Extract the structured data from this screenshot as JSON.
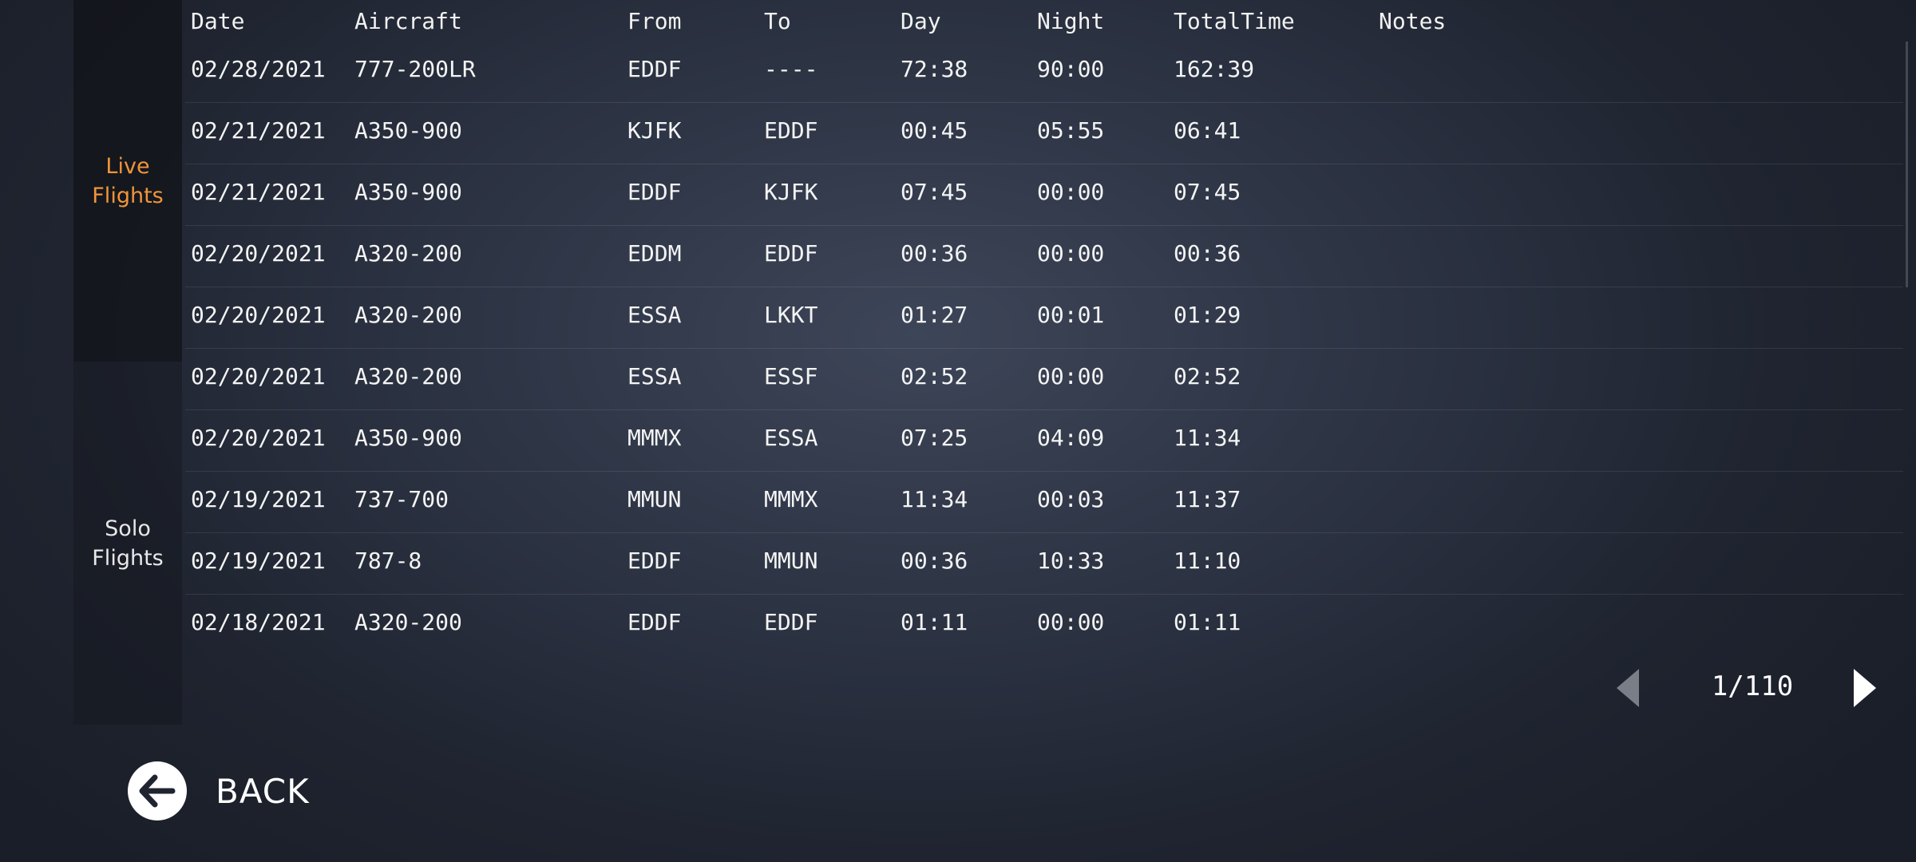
{
  "sidebar": {
    "tabs": [
      {
        "label_line1": "Live",
        "label_line2": "Flights",
        "active": true
      },
      {
        "label_line1": "Solo",
        "label_line2": "Flights",
        "active": false
      }
    ]
  },
  "table": {
    "headers": {
      "date": "Date",
      "aircraft": "Aircraft",
      "from": "From",
      "to": "To",
      "day": "Day",
      "night": "Night",
      "total": "TotalTime",
      "notes": "Notes"
    },
    "rows": [
      {
        "date": "02/28/2021",
        "aircraft": "777-200LR",
        "from": "EDDF",
        "to": "----",
        "day": "72:38",
        "night": "90:00",
        "total": "162:39",
        "notes": ""
      },
      {
        "date": "02/21/2021",
        "aircraft": "A350-900",
        "from": "KJFK",
        "to": "EDDF",
        "day": "00:45",
        "night": "05:55",
        "total": "06:41",
        "notes": ""
      },
      {
        "date": "02/21/2021",
        "aircraft": "A350-900",
        "from": "EDDF",
        "to": "KJFK",
        "day": "07:45",
        "night": "00:00",
        "total": "07:45",
        "notes": ""
      },
      {
        "date": "02/20/2021",
        "aircraft": "A320-200",
        "from": "EDDM",
        "to": "EDDF",
        "day": "00:36",
        "night": "00:00",
        "total": "00:36",
        "notes": ""
      },
      {
        "date": "02/20/2021",
        "aircraft": "A320-200",
        "from": "ESSA",
        "to": "LKKT",
        "day": "01:27",
        "night": "00:01",
        "total": "01:29",
        "notes": ""
      },
      {
        "date": "02/20/2021",
        "aircraft": "A320-200",
        "from": "ESSA",
        "to": "ESSF",
        "day": "02:52",
        "night": "00:00",
        "total": "02:52",
        "notes": ""
      },
      {
        "date": "02/20/2021",
        "aircraft": "A350-900",
        "from": "MMMX",
        "to": "ESSA",
        "day": "07:25",
        "night": "04:09",
        "total": "11:34",
        "notes": ""
      },
      {
        "date": "02/19/2021",
        "aircraft": "737-700",
        "from": "MMUN",
        "to": "MMMX",
        "day": "11:34",
        "night": "00:03",
        "total": "11:37",
        "notes": ""
      },
      {
        "date": "02/19/2021",
        "aircraft": "787-8",
        "from": "EDDF",
        "to": "MMUN",
        "day": "00:36",
        "night": "10:33",
        "total": "11:10",
        "notes": ""
      },
      {
        "date": "02/18/2021",
        "aircraft": "A320-200",
        "from": "EDDF",
        "to": "EDDF",
        "day": "01:11",
        "night": "00:00",
        "total": "01:11",
        "notes": ""
      }
    ]
  },
  "pager": {
    "label": "1/110"
  },
  "back": {
    "label": "BACK"
  },
  "colors": {
    "active_tab": "#f0953a",
    "text": "#ffffff",
    "pager_prev_disabled": "#7a7e87"
  },
  "icons": {
    "prev": "triangle-left-icon",
    "next": "triangle-right-icon",
    "back": "arrow-left-circle-icon"
  }
}
